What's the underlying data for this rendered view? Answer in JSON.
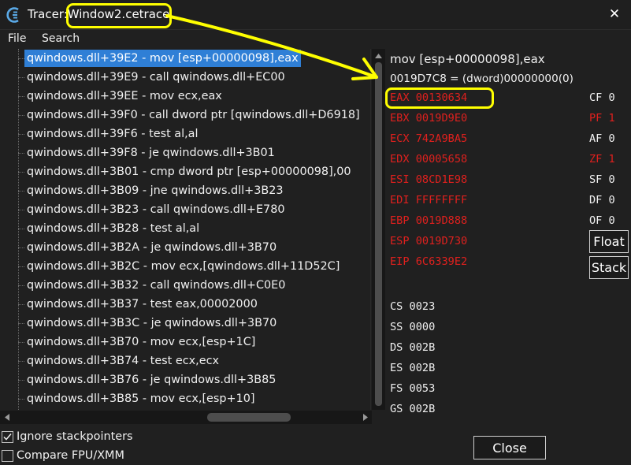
{
  "window": {
    "title": "Tracer:Window2.cetrace",
    "close_glyph": "✕"
  },
  "menu": {
    "file": "File",
    "search": "Search"
  },
  "trace_list": {
    "items": [
      "qwindows.dll+39E2 - mov [esp+00000098],eax",
      "qwindows.dll+39E9 - call qwindows.dll+EC00",
      "qwindows.dll+39EE - mov ecx,eax",
      "qwindows.dll+39F0 - call dword ptr [qwindows.dll+D6918]",
      "qwindows.dll+39F6 - test al,al",
      "qwindows.dll+39F8 - je qwindows.dll+3B01",
      "qwindows.dll+3B01 - cmp dword ptr [esp+00000098],00",
      "qwindows.dll+3B09 - jne qwindows.dll+3B23",
      "qwindows.dll+3B23 - call qwindows.dll+E780",
      "qwindows.dll+3B28 - test al,al",
      "qwindows.dll+3B2A - je qwindows.dll+3B70",
      "qwindows.dll+3B2C - mov ecx,[qwindows.dll+11D52C]",
      "qwindows.dll+3B32 - call qwindows.dll+C0E0",
      "qwindows.dll+3B37 - test eax,00002000",
      "qwindows.dll+3B3C - je qwindows.dll+3B70",
      "qwindows.dll+3B70 - mov ecx,[esp+1C]",
      "qwindows.dll+3B74 - test ecx,ecx",
      "qwindows.dll+3B76 - je qwindows.dll+3B85",
      "qwindows.dll+3B85 - mov ecx,[esp+10]"
    ],
    "selected_index": 0
  },
  "options": {
    "ignore_stackpointers": {
      "label": "Ignore stackpointers",
      "checked": true
    },
    "compare_fpu": {
      "label": "Compare FPU/XMM",
      "checked": false
    }
  },
  "details": {
    "instruction": "mov [esp+00000098],eax",
    "memory": "0019D7C8 = (dword)00000000(0)",
    "registers": [
      "EAX 00130634",
      "EBX 0019D9E0",
      "ECX 742A9BA5",
      "EDX 00005658",
      "ESI 08CD1E98",
      "EDI FFFFFFFF",
      "EBP 0019D888",
      "ESP 0019D730",
      "EIP 6C6339E2"
    ],
    "flags": [
      {
        "text": "CF 0",
        "changed": false
      },
      {
        "text": "PF 1",
        "changed": true
      },
      {
        "text": "AF 0",
        "changed": false
      },
      {
        "text": "ZF 1",
        "changed": true
      },
      {
        "text": "SF 0",
        "changed": false
      },
      {
        "text": "DF 0",
        "changed": false
      },
      {
        "text": "OF 0",
        "changed": false
      }
    ],
    "segments": [
      "CS 0023",
      "SS 0000",
      "DS 002B",
      "ES 002B",
      "FS 0053",
      "GS 002B"
    ]
  },
  "buttons": {
    "float": "Float",
    "stack": "Stack",
    "close": "Close"
  },
  "colors": {
    "background": "#202020",
    "selection": "#2f7fd6",
    "changed_value": "#e0201e",
    "annotation": "#ffff00",
    "app_icon": "#5aa9e6"
  }
}
